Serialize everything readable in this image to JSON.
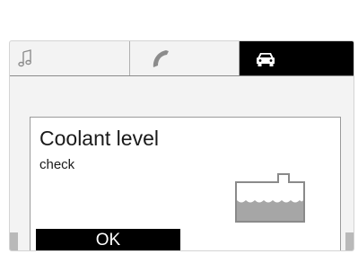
{
  "tabs": [
    {
      "id": "music",
      "icon": "music-note-icon",
      "selected": false
    },
    {
      "id": "phone",
      "icon": "phone-handset-icon",
      "selected": false
    },
    {
      "id": "vehicle",
      "icon": "car-icon",
      "selected": true
    }
  ],
  "dialog": {
    "title": "Coolant level",
    "message": "check",
    "icon": "coolant-reservoir-icon",
    "ok_label": "OK"
  },
  "colors": {
    "selected_tab_bg": "#000000",
    "button_bg": "#000000",
    "button_text": "#ffffff",
    "coolant_fill": "#a6a6a6"
  }
}
